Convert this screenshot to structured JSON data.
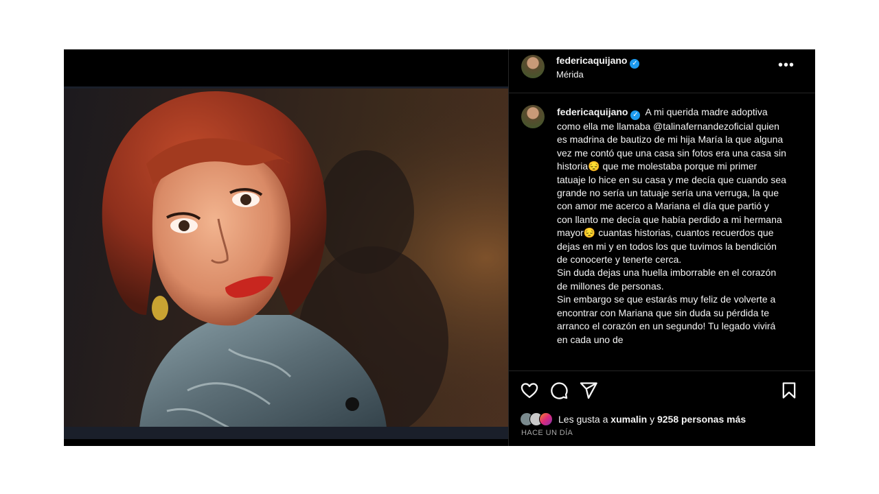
{
  "post": {
    "username": "federicaquijano",
    "location": "Mérida",
    "more_label": "•••"
  },
  "caption": {
    "username": "federicaquijano",
    "paragraphs": [
      "A mi querida madre adoptiva como ella me llamaba @talinafernandezoficial quien es madrina de bautizo de mi hija María la que alguna vez me contó que una casa sin fotos era una casa sin historia😔 que me molestaba porque mi primer tatuaje lo hice en su casa y me decía que cuando sea grande no sería un tatuaje sería una verruga, la que con amor me acerco a Mariana el día que partió y con llanto me decía que había perdido a mi hermana mayor😔 cuantas historias, cuantos recuerdos que dejas en mi y en todos los que tuvimos la bendición de conocerte y tenerte cerca.",
      "Sin duda dejas una huella imborrable en el corazón de millones de personas.",
      "Sin embargo se que estarás muy feliz de volverte a encontrar con Mariana que sin duda su pérdida te arranco el corazón en un segundo! Tu legado vivirá en cada uno de"
    ]
  },
  "likes": {
    "prefix": "Les gusta a",
    "user": "xumalin",
    "middle": "y",
    "count_text": "9258 personas más"
  },
  "timestamp": "HACE UN DÍA",
  "icons": {
    "like": "heart-icon",
    "comment": "comment-icon",
    "share": "share-icon",
    "save": "bookmark-icon"
  }
}
